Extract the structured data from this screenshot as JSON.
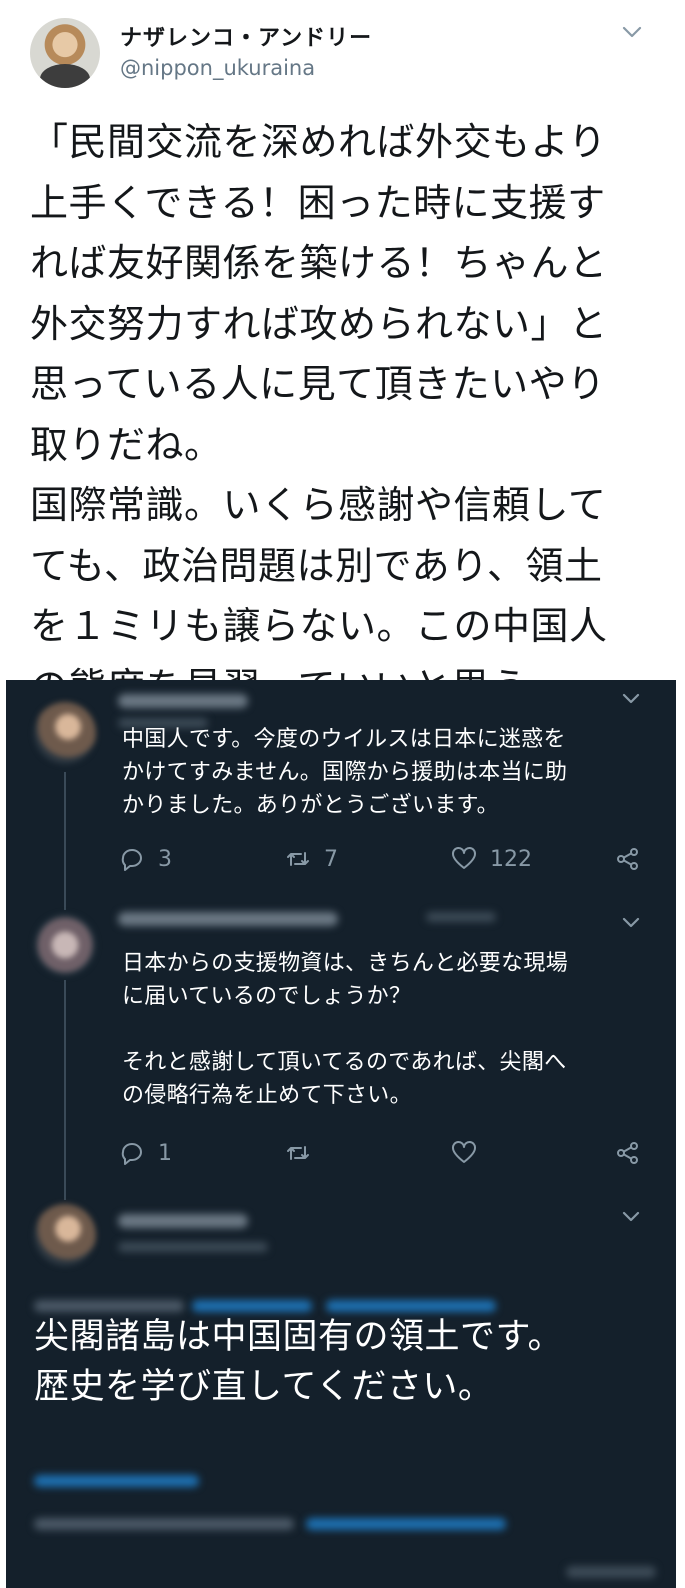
{
  "tweet": {
    "display_name": "ナザレンコ・アンドリー",
    "handle": "@nippon_ukuraina",
    "text": "「民間交流を深めれば外交もより\n上手くできる！困った時に支援す\nれば友好関係を築ける！ちゃんと\n外交努力すれば攻められない」と\n思っている人に見て頂きたいやり\n取りだね。\n国際常識。いくら感謝や信頼して\nても、政治問題は別であり、領土\nを１ミリも譲らない。この中国人\nの態度を見習っていいと思う",
    "icons": {
      "menu": "chevron-down-icon"
    }
  },
  "screenshot": {
    "background": "#14202b",
    "replies": [
      {
        "text": "中国人です。今度のウイルスは日本に迷惑を\nかけてすみません。国際から援助は本当に助\nかりました。ありがとうございます。",
        "reply_count": "3",
        "retweet_count": "7",
        "like_count": "122"
      },
      {
        "text": "日本からの支援物資は、きちんと必要な現場\nに届いているのでしょうか？\n\nそれと感謝して頂いてるのであれば、尖閣へ\nの侵略行為を止めて下さい。",
        "reply_count": "1",
        "retweet_count": "",
        "like_count": ""
      }
    ],
    "final_reply_text": "尖閣諸島は中国固有の領土です。\n歴史を学び直してください。",
    "icons": {
      "reply": "reply-icon",
      "retweet": "retweet-icon",
      "like": "heart-icon",
      "share": "share-icon",
      "menu": "chevron-down-icon"
    }
  }
}
